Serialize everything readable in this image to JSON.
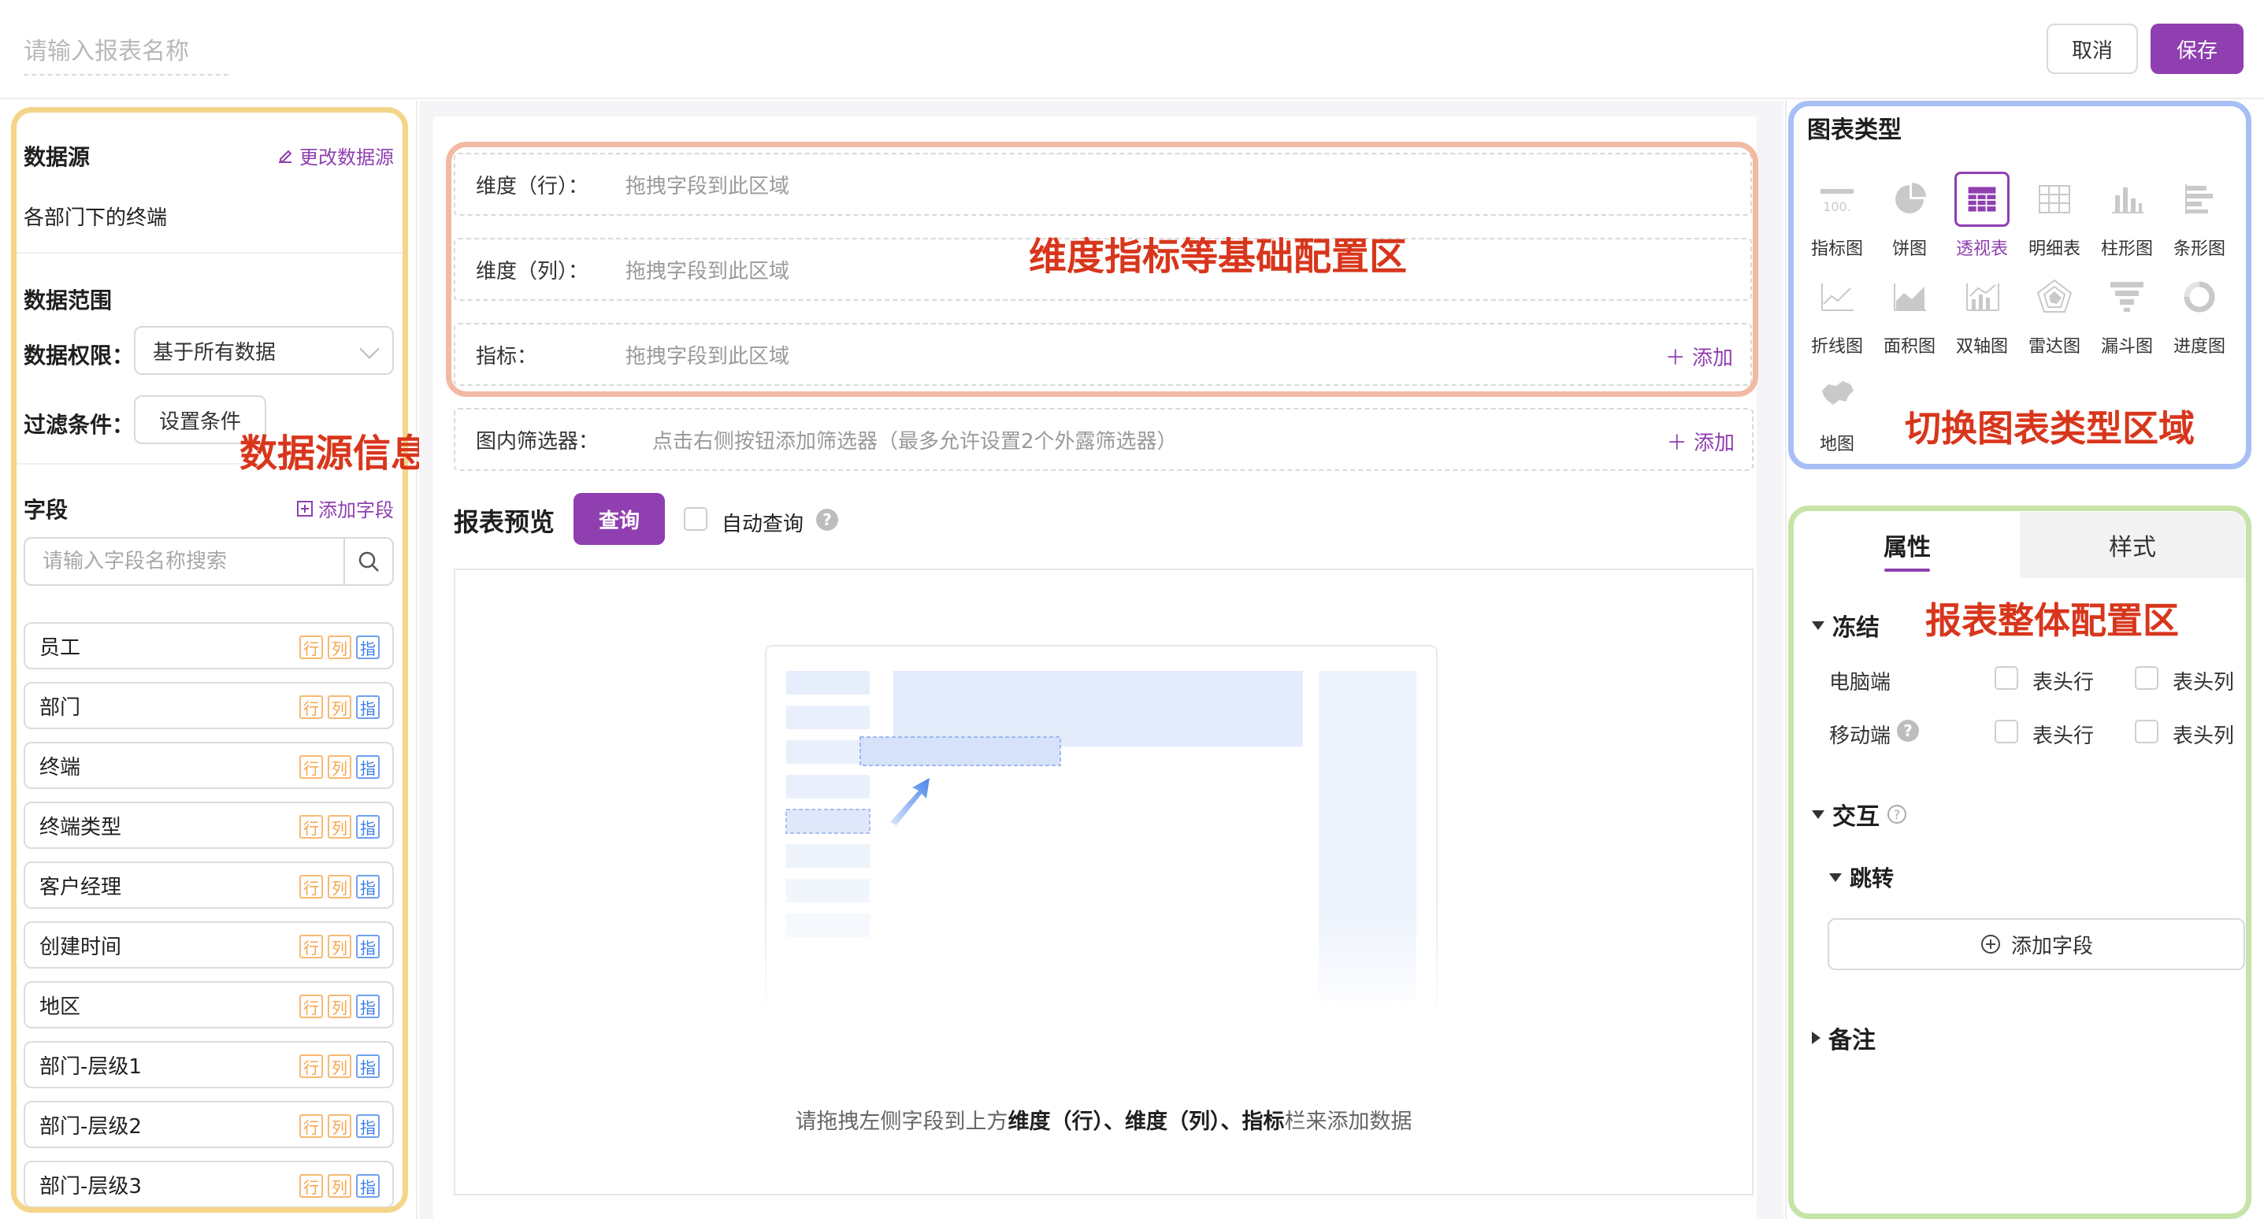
{
  "header": {
    "report_name_placeholder": "请输入报表名称",
    "cancel_label": "取消",
    "save_label": "保存"
  },
  "left": {
    "datasource_title": "数据源",
    "change_datasource_label": "更改数据源",
    "datasource_name": "各部门下的终端",
    "range_title": "数据范围",
    "permission_label": "数据权限：",
    "permission_value": "基于所有数据",
    "filter_label": "过滤条件：",
    "filter_button": "设置条件",
    "fields_title": "字段",
    "add_field_label": "添加字段",
    "search_placeholder": "请输入字段名称搜索",
    "tag_row": "行",
    "tag_col": "列",
    "tag_metric": "指",
    "fields": [
      "员工",
      "部门",
      "终端",
      "终端类型",
      "客户经理",
      "创建时间",
      "地区",
      "部门-层级1",
      "部门-层级2",
      "部门-层级3"
    ]
  },
  "middle": {
    "row_dim_label": "维度（行）：",
    "col_dim_label": "维度（列）：",
    "metric_label": "指标：",
    "drop_placeholder": "拖拽字段到此区域",
    "add_label": "添加",
    "filter_label": "图内筛选器：",
    "filter_placeholder": "点击右侧按钮添加筛选器（最多允许设置2个外露筛选器）",
    "preview_title": "报表预览",
    "query_label": "查询",
    "auto_query_label": "自动查询",
    "hint_prefix": "请拖拽左侧字段到上方",
    "hint_bold": "维度（行）、维度（列）、指标",
    "hint_suffix": "栏来添加数据"
  },
  "right": {
    "chart_type_title": "图表类型",
    "chart_types": [
      {
        "name": "指标图",
        "icon": "metric-chart-icon"
      },
      {
        "name": "饼图",
        "icon": "pie-chart-icon"
      },
      {
        "name": "透视表",
        "icon": "pivot-table-icon",
        "selected": true
      },
      {
        "name": "明细表",
        "icon": "detail-table-icon"
      },
      {
        "name": "柱形图",
        "icon": "column-chart-icon"
      },
      {
        "name": "条形图",
        "icon": "bar-chart-icon"
      },
      {
        "name": "折线图",
        "icon": "line-chart-icon"
      },
      {
        "name": "面积图",
        "icon": "area-chart-icon"
      },
      {
        "name": "双轴图",
        "icon": "dual-axis-chart-icon"
      },
      {
        "name": "雷达图",
        "icon": "radar-chart-icon"
      },
      {
        "name": "漏斗图",
        "icon": "funnel-chart-icon"
      },
      {
        "name": "进度图",
        "icon": "progress-chart-icon"
      },
      {
        "name": "地图",
        "icon": "map-chart-icon"
      }
    ],
    "tab_properties": "属性",
    "tab_style": "样式",
    "freeze_title": "冻结",
    "desktop_label": "电脑端",
    "mobile_label": "移动端",
    "header_row_label": "表头行",
    "header_col_label": "表头列",
    "interaction_title": "交互",
    "jump_title": "跳转",
    "add_field_label": "添加字段",
    "notes_title": "备注"
  },
  "annotations": {
    "datasource_info": "数据源信息",
    "dims_config": "维度指标等基础配置区",
    "chart_switch": "切换图表类型区域",
    "report_config": "报表整体配置区"
  },
  "colors": {
    "accent": "#8f3fb0",
    "annotation_text": "#d8361c",
    "left_frame": "#f5d58a",
    "dims_frame": "#f2b9a3",
    "type_frame": "#a8bff5",
    "config_frame": "#c6e3a8"
  }
}
